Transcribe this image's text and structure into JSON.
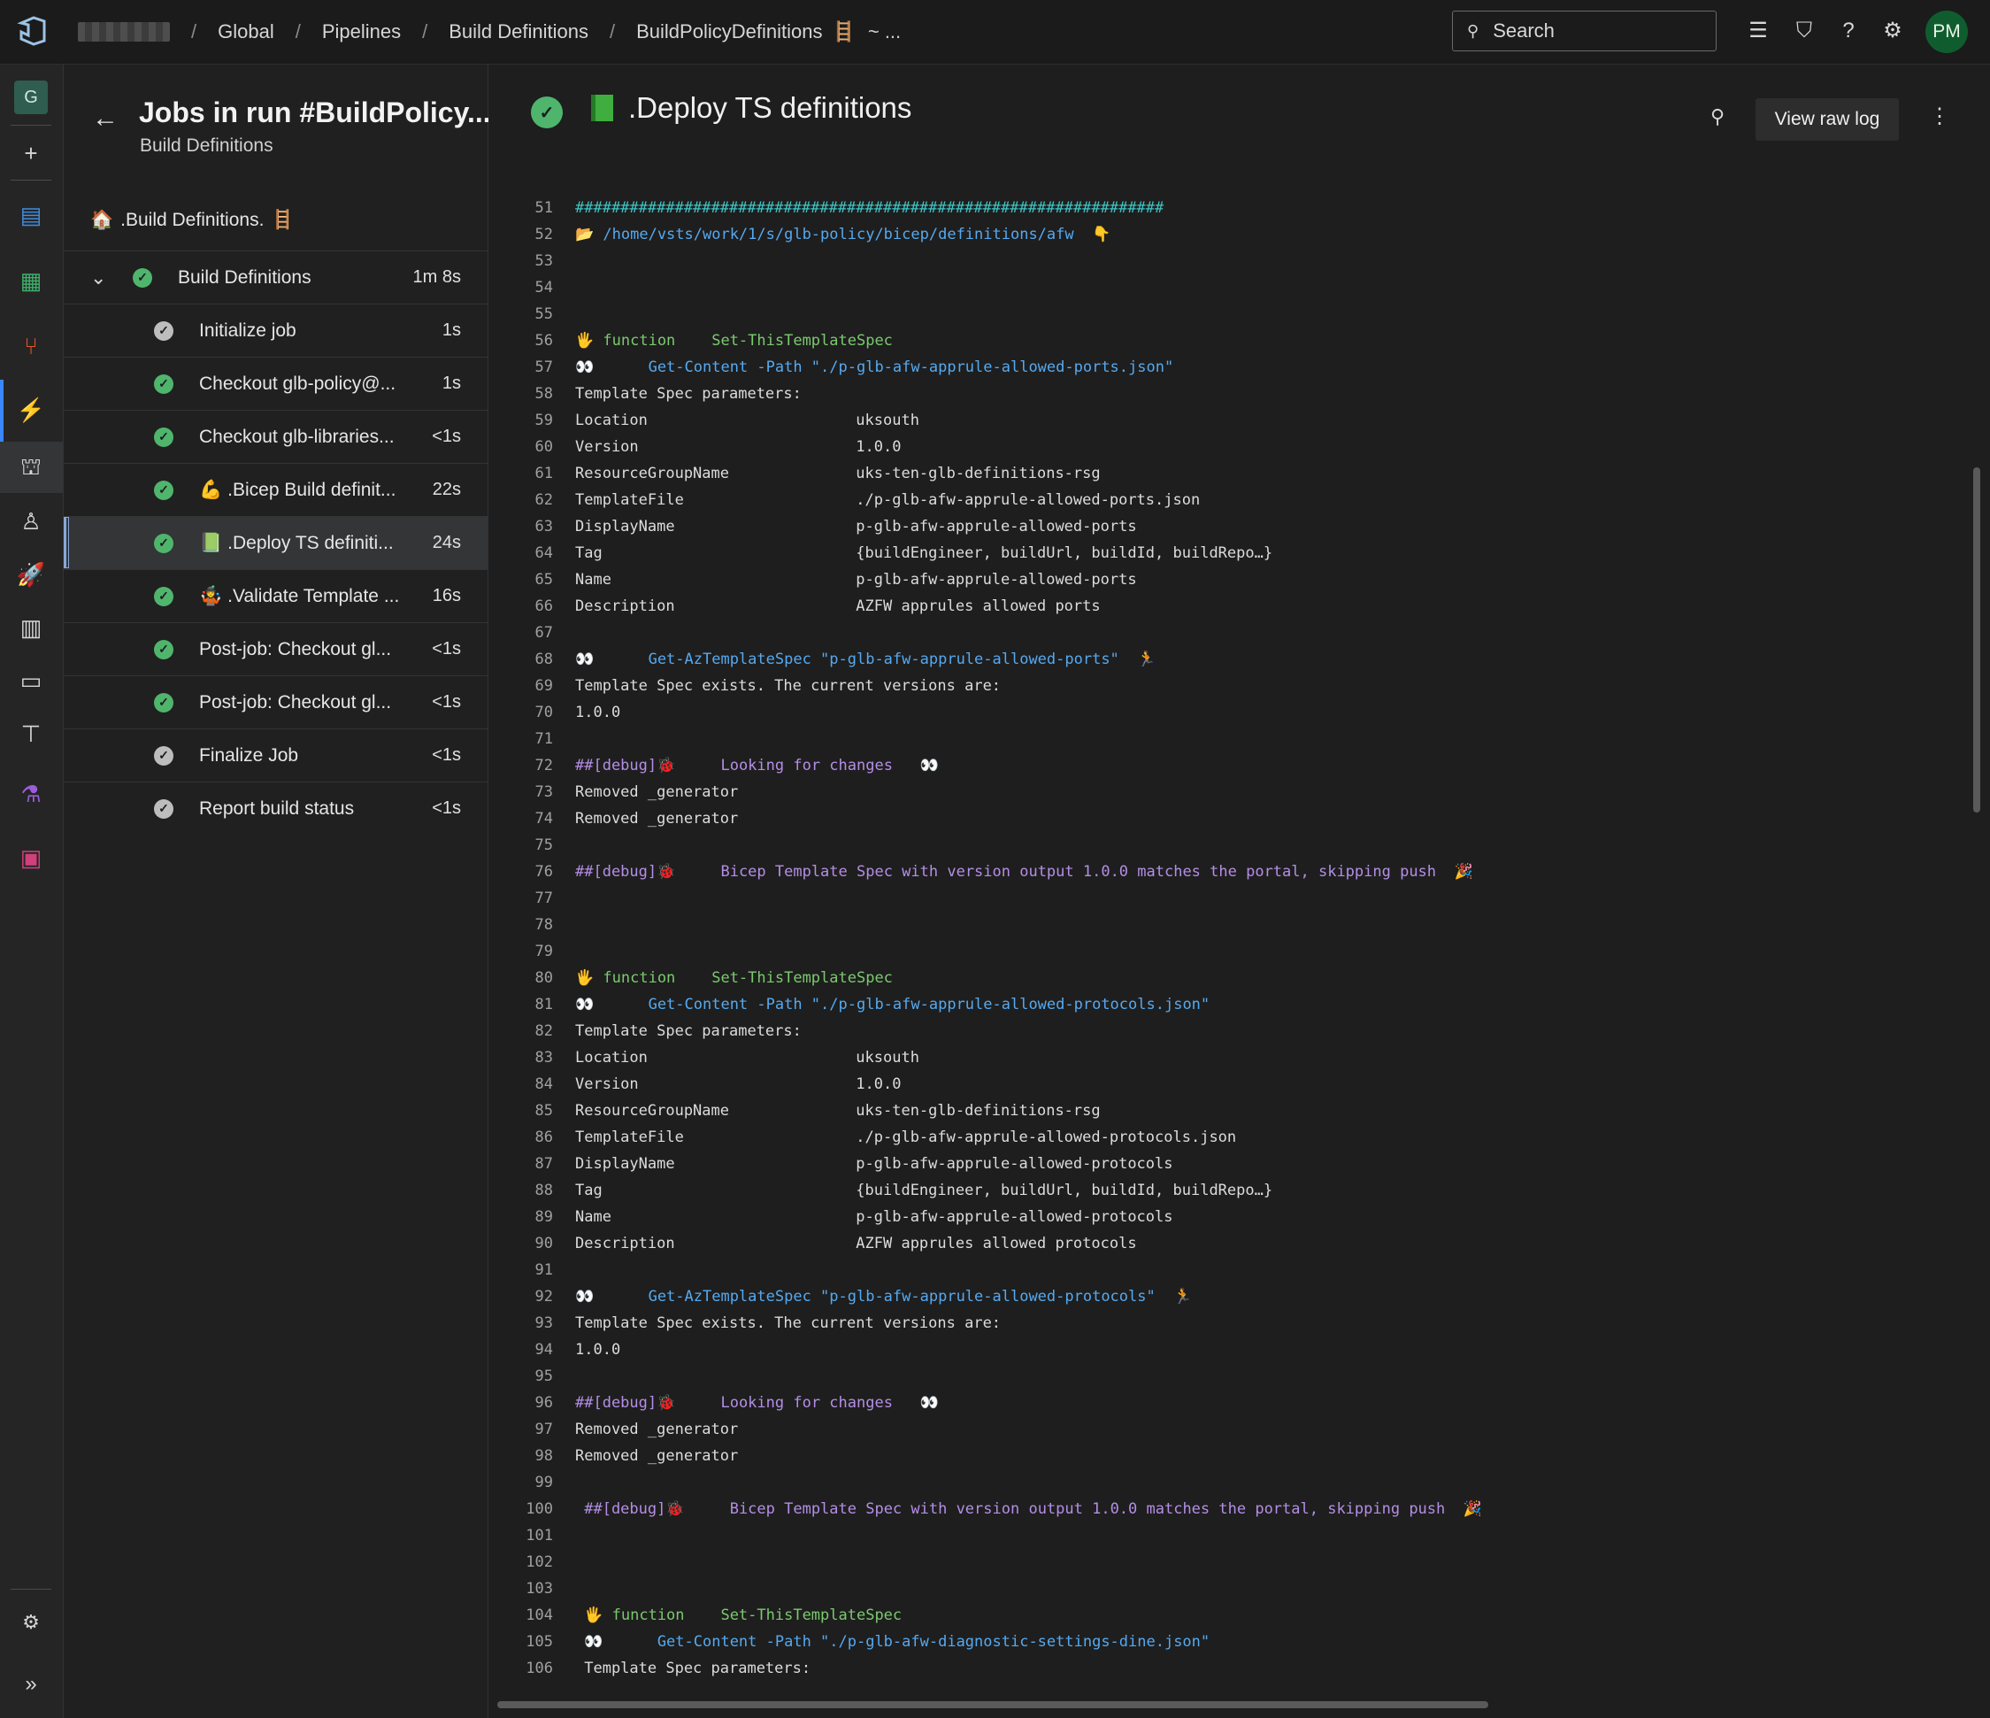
{
  "breadcrumb": {
    "items": [
      "Global",
      "Pipelines",
      "Build Definitions",
      "BuildPolicyDefinitions"
    ],
    "tail": "~ ..."
  },
  "search": {
    "placeholder": "Search"
  },
  "user": {
    "initials": "PM"
  },
  "rail": {
    "project_initial": "G"
  },
  "jobs_panel": {
    "title": "Jobs in run #BuildPolicy...",
    "subtitle": "Build Definitions",
    "stage": ".Build Definitions.",
    "job": {
      "name": "Build Definitions",
      "duration": "1m 8s"
    },
    "steps": [
      {
        "label": "Initialize job",
        "duration": "1s",
        "status": "skip",
        "emoji": ""
      },
      {
        "label": "Checkout glb-policy@...",
        "duration": "1s",
        "status": "ok",
        "emoji": ""
      },
      {
        "label": "Checkout glb-libraries...",
        "duration": "<1s",
        "status": "ok",
        "emoji": ""
      },
      {
        "label": ".Bicep Build definit...",
        "duration": "22s",
        "status": "ok",
        "emoji": "💪"
      },
      {
        "label": ".Deploy TS definiti...",
        "duration": "24s",
        "status": "ok",
        "emoji": "📗",
        "active": true
      },
      {
        "label": ".Validate Template ...",
        "duration": "16s",
        "status": "ok",
        "emoji": "🤹"
      },
      {
        "label": "Post-job: Checkout gl...",
        "duration": "<1s",
        "status": "ok",
        "emoji": ""
      },
      {
        "label": "Post-job: Checkout gl...",
        "duration": "<1s",
        "status": "ok",
        "emoji": ""
      },
      {
        "label": "Finalize Job",
        "duration": "<1s",
        "status": "skip",
        "emoji": ""
      },
      {
        "label": "Report build status",
        "duration": "<1s",
        "status": "skip",
        "emoji": ""
      }
    ]
  },
  "log": {
    "title": ".Deploy TS definitions",
    "raw_button": "View raw log",
    "lines": [
      {
        "n": "51",
        "parts": [
          {
            "t": "#################################################################",
            "c": "c-cyan"
          }
        ]
      },
      {
        "n": "52",
        "parts": [
          {
            "t": "📂 ",
            "c": "c-ico"
          },
          {
            "t": "/home/vsts/work/1/s/glb-policy/bicep/definitions/afw",
            "c": "c-blue"
          },
          {
            "t": "  👇",
            "c": "c-ico"
          }
        ]
      },
      {
        "n": "53",
        "parts": []
      },
      {
        "n": "54",
        "parts": []
      },
      {
        "n": "55",
        "parts": []
      },
      {
        "n": "56",
        "parts": [
          {
            "t": "🖐 ",
            "c": "c-ico"
          },
          {
            "t": "function    Set-ThisTemplateSpec",
            "c": "c-green"
          }
        ]
      },
      {
        "n": "57",
        "parts": [
          {
            "t": "👀 ",
            "c": "c-red"
          },
          {
            "t": "     Get-Content -Path \"./p-glb-afw-apprule-allowed-ports.json\"",
            "c": "c-blue"
          }
        ]
      },
      {
        "n": "58",
        "parts": [
          {
            "t": "Template Spec parameters:",
            "c": ""
          }
        ]
      },
      {
        "n": "59",
        "parts": [
          {
            "t": "Location                       uksouth",
            "c": ""
          }
        ]
      },
      {
        "n": "60",
        "parts": [
          {
            "t": "Version                        1.0.0",
            "c": ""
          }
        ]
      },
      {
        "n": "61",
        "parts": [
          {
            "t": "ResourceGroupName              uks-ten-glb-definitions-rsg",
            "c": ""
          }
        ]
      },
      {
        "n": "62",
        "parts": [
          {
            "t": "TemplateFile                   ./p-glb-afw-apprule-allowed-ports.json",
            "c": ""
          }
        ]
      },
      {
        "n": "63",
        "parts": [
          {
            "t": "DisplayName                    p-glb-afw-apprule-allowed-ports",
            "c": ""
          }
        ]
      },
      {
        "n": "64",
        "parts": [
          {
            "t": "Tag                            {buildEngineer, buildUrl, buildId, buildRepo…}",
            "c": ""
          }
        ]
      },
      {
        "n": "65",
        "parts": [
          {
            "t": "Name                           p-glb-afw-apprule-allowed-ports",
            "c": ""
          }
        ]
      },
      {
        "n": "66",
        "parts": [
          {
            "t": "Description                    AZFW apprules allowed ports",
            "c": ""
          }
        ]
      },
      {
        "n": "67",
        "parts": []
      },
      {
        "n": "68",
        "parts": [
          {
            "t": "👀 ",
            "c": "c-red"
          },
          {
            "t": "     Get-AzTemplateSpec \"p-glb-afw-apprule-allowed-ports\"",
            "c": "c-blue"
          },
          {
            "t": "  🏃",
            "c": "c-ico"
          }
        ]
      },
      {
        "n": "69",
        "parts": [
          {
            "t": "Template Spec exists. The current versions are:",
            "c": ""
          }
        ]
      },
      {
        "n": "70",
        "parts": [
          {
            "t": "1.0.0",
            "c": ""
          }
        ]
      },
      {
        "n": "71",
        "parts": []
      },
      {
        "n": "72",
        "parts": [
          {
            "t": "##[debug]",
            "c": "c-purple"
          },
          {
            "t": "🐞",
            "c": "c-red"
          },
          {
            "t": "     Looking for changes  ",
            "c": "c-purple"
          },
          {
            "t": " 👀",
            "c": ""
          }
        ]
      },
      {
        "n": "73",
        "parts": [
          {
            "t": "Removed _generator",
            "c": ""
          }
        ]
      },
      {
        "n": "74",
        "parts": [
          {
            "t": "Removed _generator",
            "c": ""
          }
        ]
      },
      {
        "n": "75",
        "parts": []
      },
      {
        "n": "76",
        "parts": [
          {
            "t": "##[debug]",
            "c": "c-purple"
          },
          {
            "t": "🐞",
            "c": "c-red"
          },
          {
            "t": "     Bicep Template Spec with version output 1.0.0 matches the portal, skipping push  ",
            "c": "c-purple"
          },
          {
            "t": "🎉",
            "c": "c-ico"
          }
        ]
      },
      {
        "n": "77",
        "parts": []
      },
      {
        "n": "78",
        "parts": []
      },
      {
        "n": "79",
        "parts": []
      },
      {
        "n": "80",
        "parts": [
          {
            "t": "🖐 ",
            "c": "c-ico"
          },
          {
            "t": "function    Set-ThisTemplateSpec",
            "c": "c-green"
          }
        ]
      },
      {
        "n": "81",
        "parts": [
          {
            "t": "👀 ",
            "c": "c-red"
          },
          {
            "t": "     Get-Content -Path \"./p-glb-afw-apprule-allowed-protocols.json\"",
            "c": "c-blue"
          }
        ]
      },
      {
        "n": "82",
        "parts": [
          {
            "t": "Template Spec parameters:",
            "c": ""
          }
        ]
      },
      {
        "n": "83",
        "parts": [
          {
            "t": "Location                       uksouth",
            "c": ""
          }
        ]
      },
      {
        "n": "84",
        "parts": [
          {
            "t": "Version                        1.0.0",
            "c": ""
          }
        ]
      },
      {
        "n": "85",
        "parts": [
          {
            "t": "ResourceGroupName              uks-ten-glb-definitions-rsg",
            "c": ""
          }
        ]
      },
      {
        "n": "86",
        "parts": [
          {
            "t": "TemplateFile                   ./p-glb-afw-apprule-allowed-protocols.json",
            "c": ""
          }
        ]
      },
      {
        "n": "87",
        "parts": [
          {
            "t": "DisplayName                    p-glb-afw-apprule-allowed-protocols",
            "c": ""
          }
        ]
      },
      {
        "n": "88",
        "parts": [
          {
            "t": "Tag                            {buildEngineer, buildUrl, buildId, buildRepo…}",
            "c": ""
          }
        ]
      },
      {
        "n": "89",
        "parts": [
          {
            "t": "Name                           p-glb-afw-apprule-allowed-protocols",
            "c": ""
          }
        ]
      },
      {
        "n": "90",
        "parts": [
          {
            "t": "Description                    AZFW apprules allowed protocols",
            "c": ""
          }
        ]
      },
      {
        "n": "91",
        "parts": []
      },
      {
        "n": "92",
        "parts": [
          {
            "t": "👀 ",
            "c": "c-red"
          },
          {
            "t": "     Get-AzTemplateSpec \"p-glb-afw-apprule-allowed-protocols\"",
            "c": "c-blue"
          },
          {
            "t": "  🏃",
            "c": "c-ico"
          }
        ]
      },
      {
        "n": "93",
        "parts": [
          {
            "t": "Template Spec exists. The current versions are:",
            "c": ""
          }
        ]
      },
      {
        "n": "94",
        "parts": [
          {
            "t": "1.0.0",
            "c": ""
          }
        ]
      },
      {
        "n": "95",
        "parts": []
      },
      {
        "n": "96",
        "parts": [
          {
            "t": "##[debug]",
            "c": "c-purple"
          },
          {
            "t": "🐞",
            "c": "c-red"
          },
          {
            "t": "     Looking for changes  ",
            "c": "c-purple"
          },
          {
            "t": " 👀",
            "c": ""
          }
        ]
      },
      {
        "n": "97",
        "parts": [
          {
            "t": "Removed _generator",
            "c": ""
          }
        ]
      },
      {
        "n": "98",
        "parts": [
          {
            "t": "Removed _generator",
            "c": ""
          }
        ]
      },
      {
        "n": "99",
        "parts": []
      },
      {
        "n": "100",
        "parts": [
          {
            "t": " ##[debug]",
            "c": "c-purple"
          },
          {
            "t": "🐞",
            "c": "c-red"
          },
          {
            "t": "     Bicep Template Spec with version output 1.0.0 matches the portal, skipping push  ",
            "c": "c-purple"
          },
          {
            "t": "🎉",
            "c": "c-ico"
          }
        ]
      },
      {
        "n": "101",
        "parts": []
      },
      {
        "n": "102",
        "parts": []
      },
      {
        "n": "103",
        "parts": []
      },
      {
        "n": "104",
        "parts": [
          {
            "t": " 🖐 ",
            "c": "c-ico"
          },
          {
            "t": "function    Set-ThisTemplateSpec",
            "c": "c-green"
          }
        ]
      },
      {
        "n": "105",
        "parts": [
          {
            "t": " 👀 ",
            "c": "c-red"
          },
          {
            "t": "     Get-Content -Path \"./p-glb-afw-diagnostic-settings-dine.json\"",
            "c": "c-blue"
          }
        ]
      },
      {
        "n": "106",
        "parts": [
          {
            "t": " Template Spec parameters:",
            "c": ""
          }
        ]
      }
    ]
  },
  "colors": {
    "success": "#4fb56d",
    "accent": "#3a86ff",
    "background": "#1e1e1e"
  }
}
